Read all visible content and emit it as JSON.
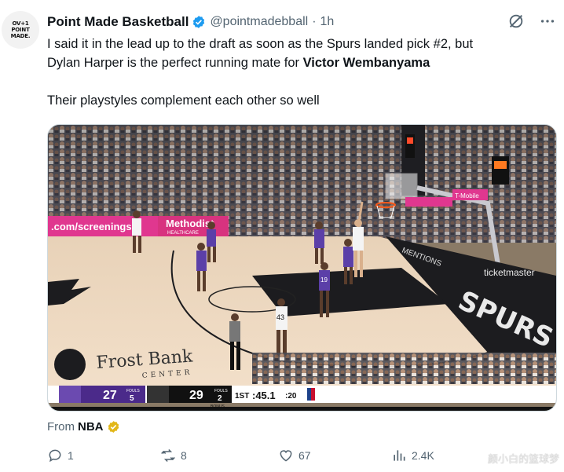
{
  "avatar": {
    "line1": "OV+1",
    "line2": "POINT",
    "line3": "MADE."
  },
  "author": {
    "name": "Point Made Basketball",
    "handle": "@pointmadebball",
    "separator": "·",
    "time": "1h"
  },
  "tweet": {
    "line1": "I said it in the lead up to the draft as soon as the Spurs landed pick #2, but",
    "line2_prefix": "Dylan Harper is the perfect running mate for ",
    "line2_bold": "Victor Wembanyama",
    "line3": "Their playstyles complement each other so well"
  },
  "media": {
    "ads": {
      "screenings": ".com/screenings",
      "methodist": "Methodist",
      "methodist_sub": "HEALTHCARE",
      "sponsor": "Frost Bank",
      "sponsor_sub": "CENTER",
      "ticketmaster": "ticketmaster",
      "spurs_floor": "SPURS",
      "mentions": "MENTIONS",
      "tmobile": "T-Mobile"
    },
    "players": {
      "jersey_43": "43",
      "jersey_19": "19"
    },
    "scoreboard": {
      "away_score": "27",
      "away_fouls_label": "FOULS",
      "away_fouls": "5",
      "home_score": "29",
      "home_fouls_label": "FOULS",
      "home_fouls": "2",
      "bonus": "BONUS",
      "quarter": "1ST",
      "clock": ":45.1",
      "shot_clock": ":20",
      "league": "NBA"
    }
  },
  "source": {
    "prefix": "From",
    "name": "NBA"
  },
  "actions": {
    "replies": "1",
    "reposts": "8",
    "likes": "67",
    "views": "2.4K"
  },
  "watermark": "颜小白的篮球梦",
  "colors": {
    "verified": "#1d9bf0",
    "text_secondary": "#536471",
    "jazz_purple": "#4b2a8a",
    "spurs_black": "#111111"
  }
}
